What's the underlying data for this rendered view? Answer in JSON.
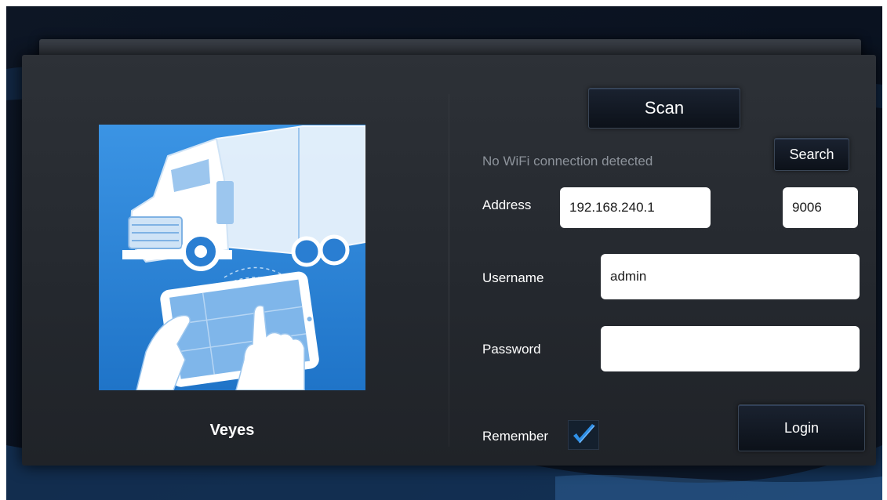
{
  "app": {
    "name": "Veyes"
  },
  "connection": {
    "scan_label": "Scan",
    "status": "No WiFi connection detected",
    "search_label": "Search",
    "address_label": "Address",
    "address_value": "192.168.240.1",
    "port_value": "9006"
  },
  "login": {
    "username_label": "Username",
    "username_value": "admin",
    "password_label": "Password",
    "password_value": "",
    "remember_label": "Remember",
    "remember_checked": true,
    "login_label": "Login"
  },
  "colors": {
    "illustration_blue": "#2d87da",
    "check_blue": "#2f8fe6",
    "dialog": "#26292f"
  },
  "icons": {
    "remember_check": "checkmark-icon",
    "illustration": "truck-tablet-illustration"
  }
}
